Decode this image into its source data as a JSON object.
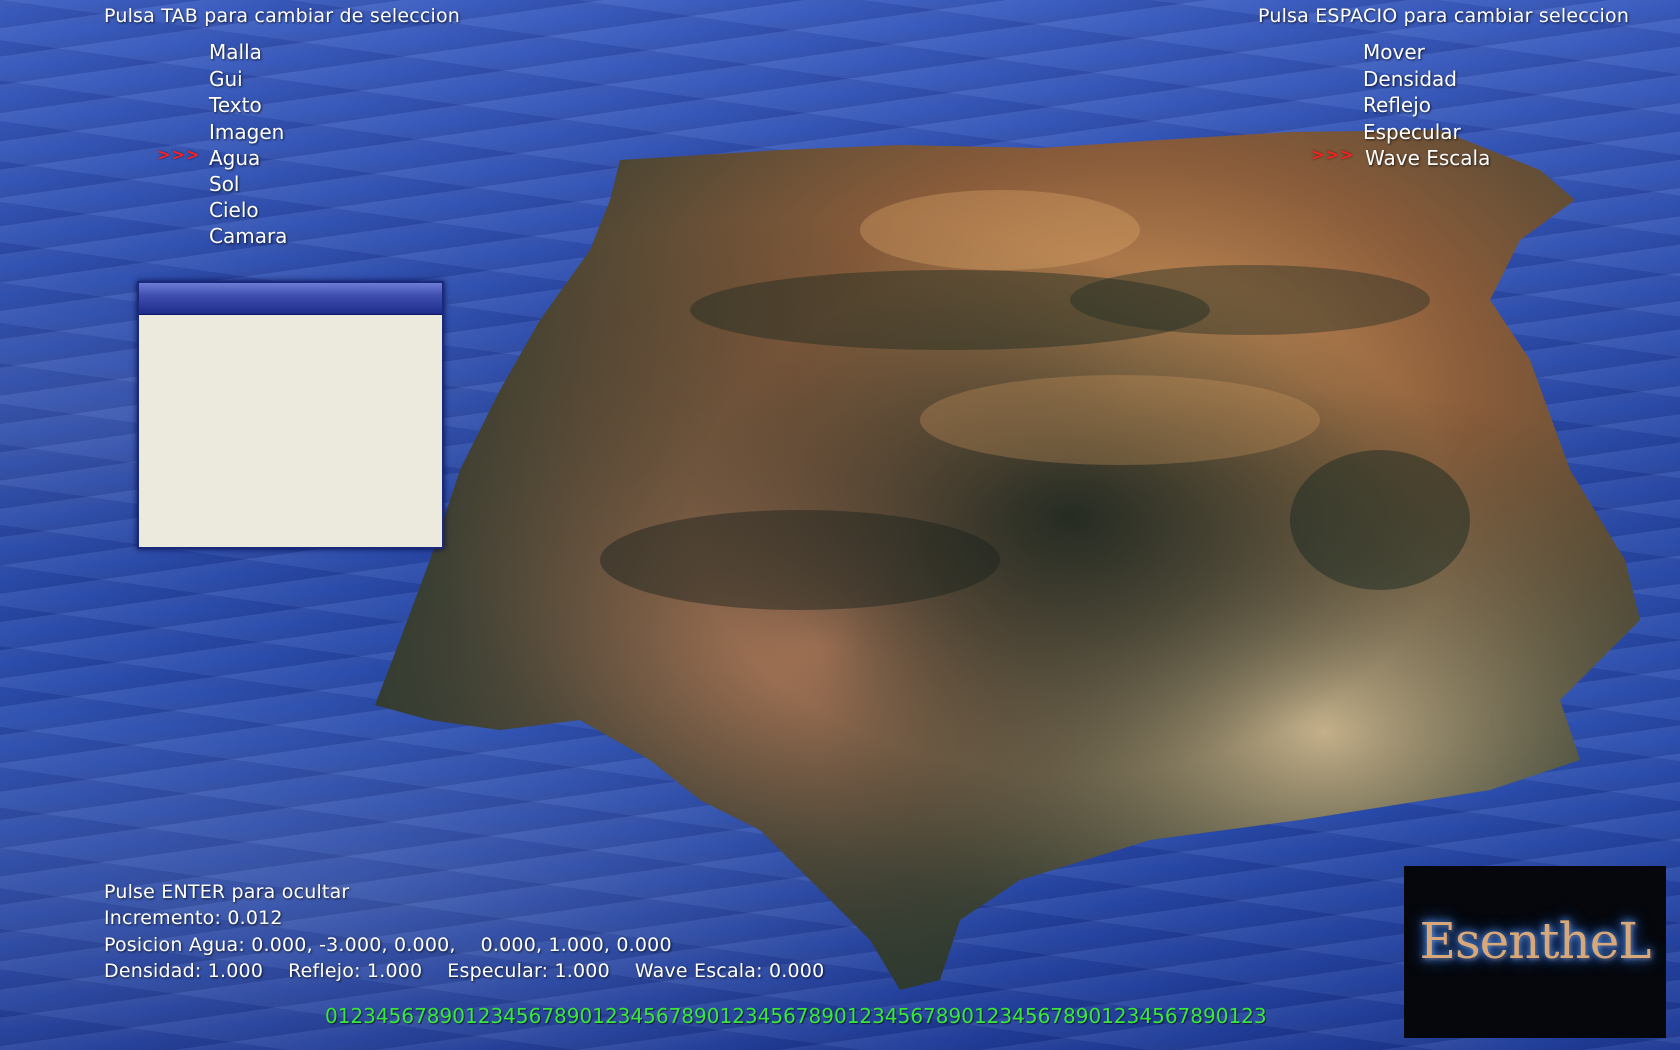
{
  "left_menu": {
    "header": "Pulsa TAB para cambiar de seleccion",
    "items": [
      "Malla",
      "Gui",
      "Texto",
      "Imagen",
      "Agua",
      "Sol",
      "Cielo",
      "Camara"
    ],
    "selected": "Agua",
    "marker": ">>>"
  },
  "right_menu": {
    "header": "Pulsa ESPACIO para cambiar seleccion",
    "items": [
      "Mover",
      "Densidad",
      "Reflejo",
      "Especular",
      "Wave Escala"
    ],
    "selected": "Wave Escala",
    "marker": ">>>"
  },
  "status": {
    "line1": "Pulse ENTER para ocultar",
    "line2": "Incremento: 0.012",
    "line3": "Posicion Agua: 0.000, -3.000, 0.000,    0.000, 1.000, 0.000",
    "line4": "Densidad: 1.000    Reflejo: 1.000    Especular: 1.000    Wave Escala: 0.000"
  },
  "digits_text": "01234567890123456789012345678901234567890123456789012345678901234567890123",
  "logo_text": "EsenthеL",
  "colors": {
    "marker": "#ff2020",
    "digits": "#39e83a",
    "water": "#2a4aa8",
    "window_title": "#1d2b8a",
    "window_body": "#ece9dd"
  }
}
